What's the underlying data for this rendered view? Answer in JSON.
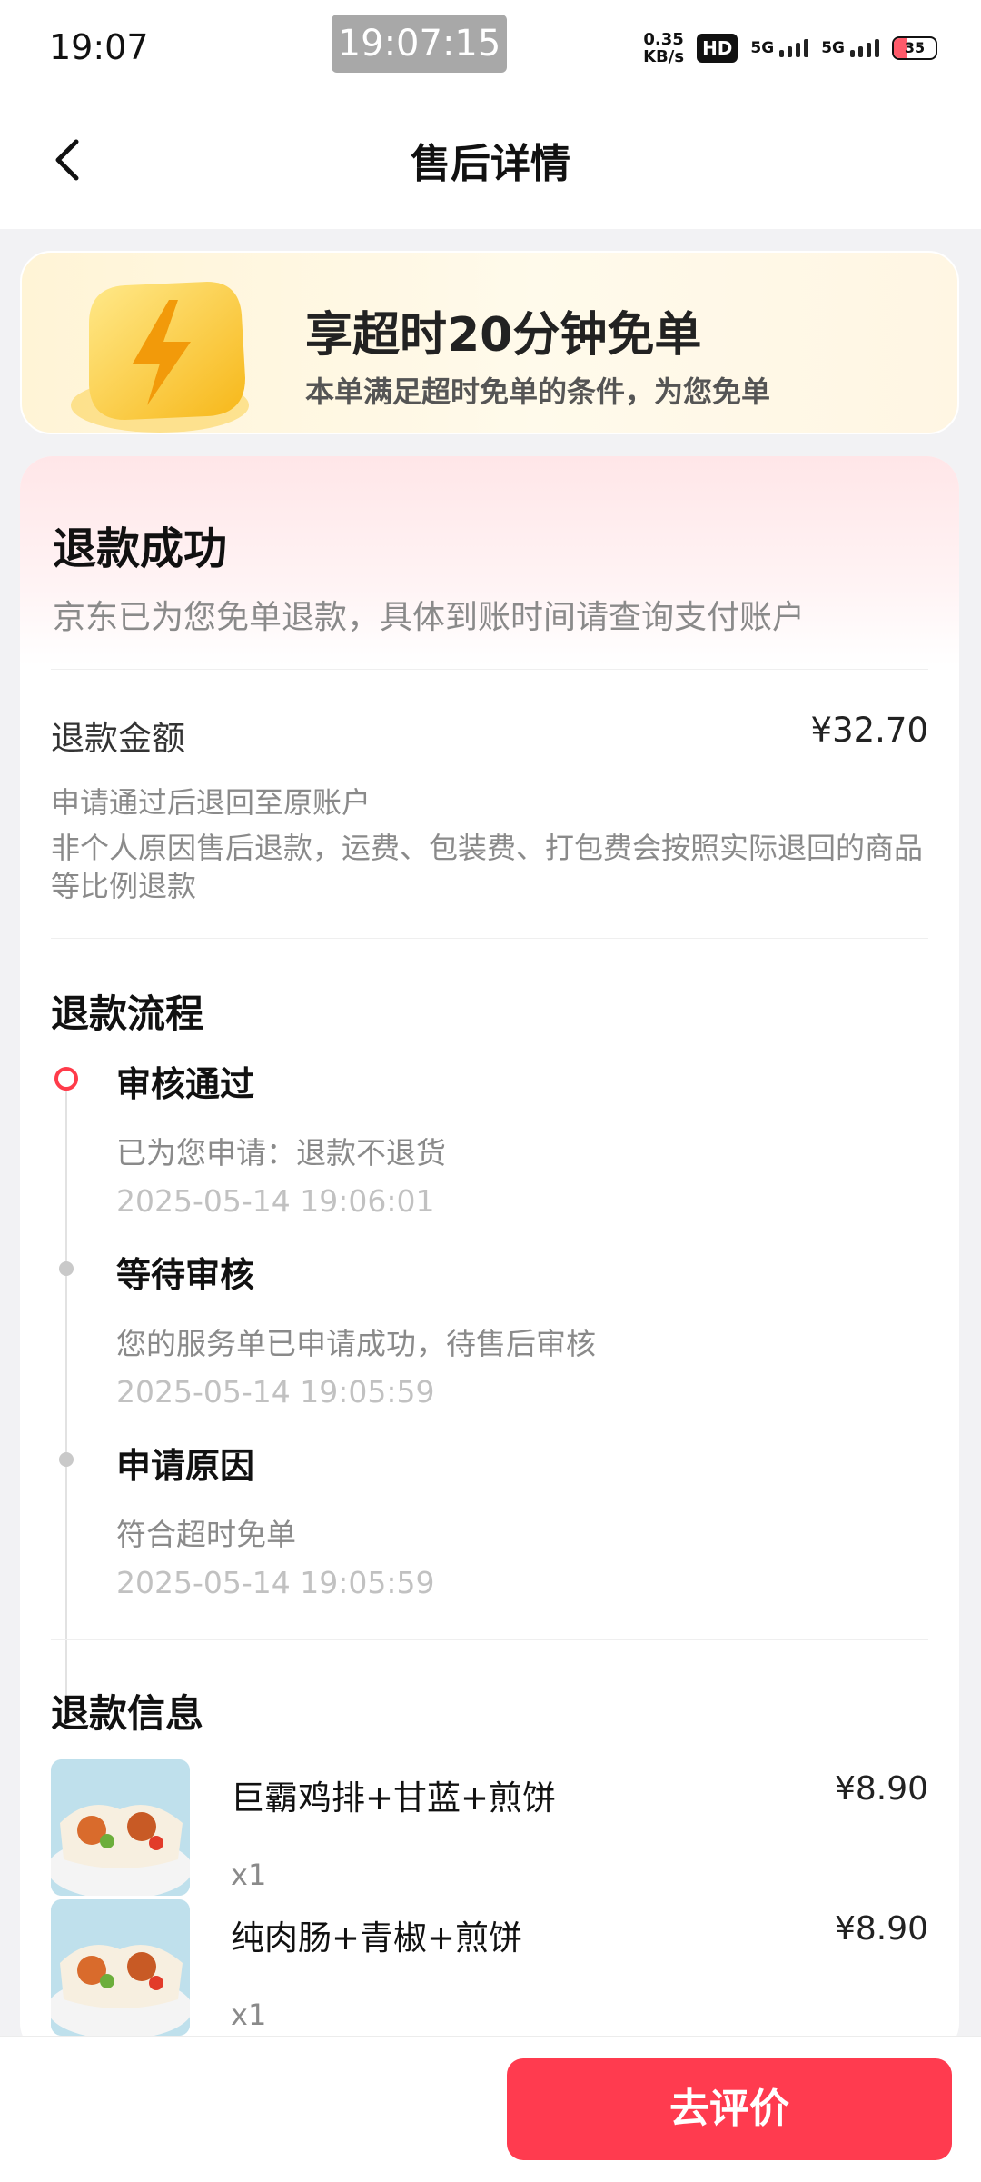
{
  "status_bar": {
    "time": "19:07",
    "recording_time": "19:07:15",
    "net_speed_value": "0.35",
    "net_speed_unit": "KB/s",
    "hd_label": "HD",
    "signal_1": "5G",
    "signal_2": "5G",
    "battery": "35"
  },
  "nav": {
    "title": "售后详情",
    "back_icon": "chevron-left-icon"
  },
  "promo": {
    "icon": "lightning-badge-icon",
    "title": "享超时20分钟免单",
    "subtitle": "本单满足超时免单的条件，为您免单"
  },
  "refund_status": {
    "title": "退款成功",
    "description": "京东已为您免单退款，具体到账时间请查询支付账户"
  },
  "refund_amount": {
    "label": "退款金额",
    "value": "¥32.70",
    "note_1": "申请通过后退回至原账户",
    "note_2_line1": "非个人原因售后退款，运费、包装费、打包费会按照实际退回的商品",
    "note_2_line2": "等比例退款"
  },
  "refund_process": {
    "title": "退款流程",
    "steps": [
      {
        "title": "审核通过",
        "desc": "已为您申请：退款不退货",
        "time": "2025-05-14 19:06:01",
        "active": true
      },
      {
        "title": "等待审核",
        "desc": "您的服务单已申请成功，待售后审核",
        "time": "2025-05-14 19:05:59",
        "active": false
      },
      {
        "title": "申请原因",
        "desc": "符合超时免单",
        "time": "2025-05-14 19:05:59",
        "active": false
      }
    ]
  },
  "refund_info": {
    "title": "退款信息",
    "items": [
      {
        "name": "巨霸鸡排+甘蓝+煎饼",
        "price": "¥8.90",
        "qty": "x1"
      },
      {
        "name": "纯肉肠+青椒+煎饼",
        "price": "¥8.90",
        "qty": "x1"
      }
    ]
  },
  "bottom_bar": {
    "review_button": "去评价"
  },
  "colors": {
    "accent": "#ff3b4f",
    "timeline_active": "#ff3b4a",
    "muted_text": "#8a8a8a"
  }
}
